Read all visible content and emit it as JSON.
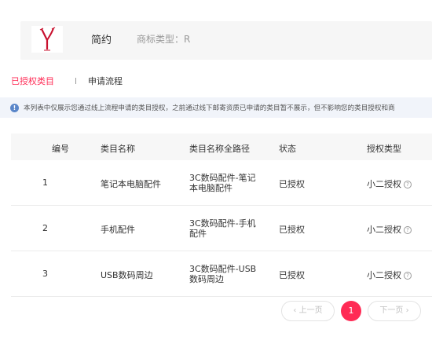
{
  "brand": {
    "name": "简约",
    "type_label": "商标类型：R",
    "logo_color": "#c8102e"
  },
  "tabs": {
    "active_label": "已授权类目",
    "other_label": "申请流程"
  },
  "notice": {
    "text": "本列表中仅展示您通过线上流程申请的类目授权，之前通过线下邮寄资质已申请的类目暂不展示，但不影响您的类目授权和商"
  },
  "table": {
    "headers": [
      "编号",
      "类目名称",
      "类目名称全路径",
      "状态",
      "授权类型"
    ],
    "rows": [
      {
        "id": "1",
        "name": "笔记本电脑配件",
        "path": "3C数码配件-笔记本电脑配件",
        "status": "已授权",
        "auth_type": "小二授权"
      },
      {
        "id": "2",
        "name": "手机配件",
        "path": "3C数码配件-手机配件",
        "status": "已授权",
        "auth_type": "小二授权"
      },
      {
        "id": "3",
        "name": "USB数码周边",
        "path": "3C数码配件-USB数码周边",
        "status": "已授权",
        "auth_type": "小二授权"
      }
    ]
  },
  "pagination": {
    "prev_label": "‹ 上一页",
    "current_page": "1",
    "next_label": "下一页 ›"
  },
  "colors": {
    "accent": "#ff2b55",
    "info": "#5a86c9"
  }
}
